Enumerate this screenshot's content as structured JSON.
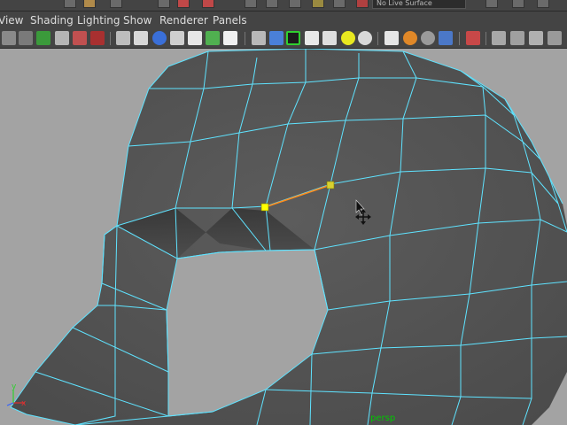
{
  "window": {
    "top_field_text": "No Live Surface"
  },
  "menubar": {
    "items": [
      "View",
      "Shading",
      "Lighting",
      "Show",
      "Renderer",
      "Panels"
    ]
  },
  "viewport": {
    "camera": "persp",
    "axes": {
      "x": "x",
      "y": "y"
    },
    "colors": {
      "background": "#a3a3a3",
      "wireframe": "#5fe3ff",
      "selected_edge": "#ff8c1a",
      "vertex": "#ffff00",
      "axis_x": "#e03030",
      "axis_y": "#30d030",
      "axis_z": "#3060ff"
    }
  },
  "icons": [
    "select-tool-icon",
    "lasso-icon",
    "paint-select-icon",
    "move-icon",
    "rotate-icon",
    "scale-icon",
    "camera-attributes-icon",
    "image-plane-icon",
    "bookmark-icon",
    "grid-icon",
    "film-gate-icon",
    "resolution-gate-icon",
    "wireframe-icon",
    "smooth-shade-icon",
    "shaded-wireframe-icon",
    "textured-icon",
    "use-all-lights-icon",
    "shadows-icon",
    "xray-icon",
    "isolate-select-icon"
  ]
}
